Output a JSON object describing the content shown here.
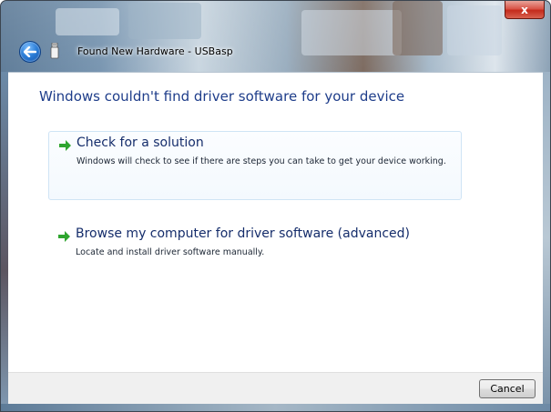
{
  "window": {
    "title": "Found New Hardware - USBasp",
    "close_glyph": "x"
  },
  "content": {
    "heading": "Windows couldn't find driver software for your device",
    "options": [
      {
        "label": "Check for a solution",
        "description": "Windows will check to see if there are steps you can take to get your device working.",
        "icon": "green-arrow-icon"
      },
      {
        "label": "Browse my computer for driver software (advanced)",
        "description": "Locate and install driver software manually.",
        "icon": "green-arrow-icon"
      }
    ]
  },
  "footer": {
    "cancel_label": "Cancel"
  },
  "icons": {
    "back": "back-arrow-icon",
    "device": "usb-device-icon",
    "close": "close-icon"
  },
  "colors": {
    "heading": "#1e3d8a",
    "option_label": "#152d6b",
    "arrow": "#2fa52f",
    "close_button": "#c42b1c",
    "back_button": "#2d7fd8"
  }
}
